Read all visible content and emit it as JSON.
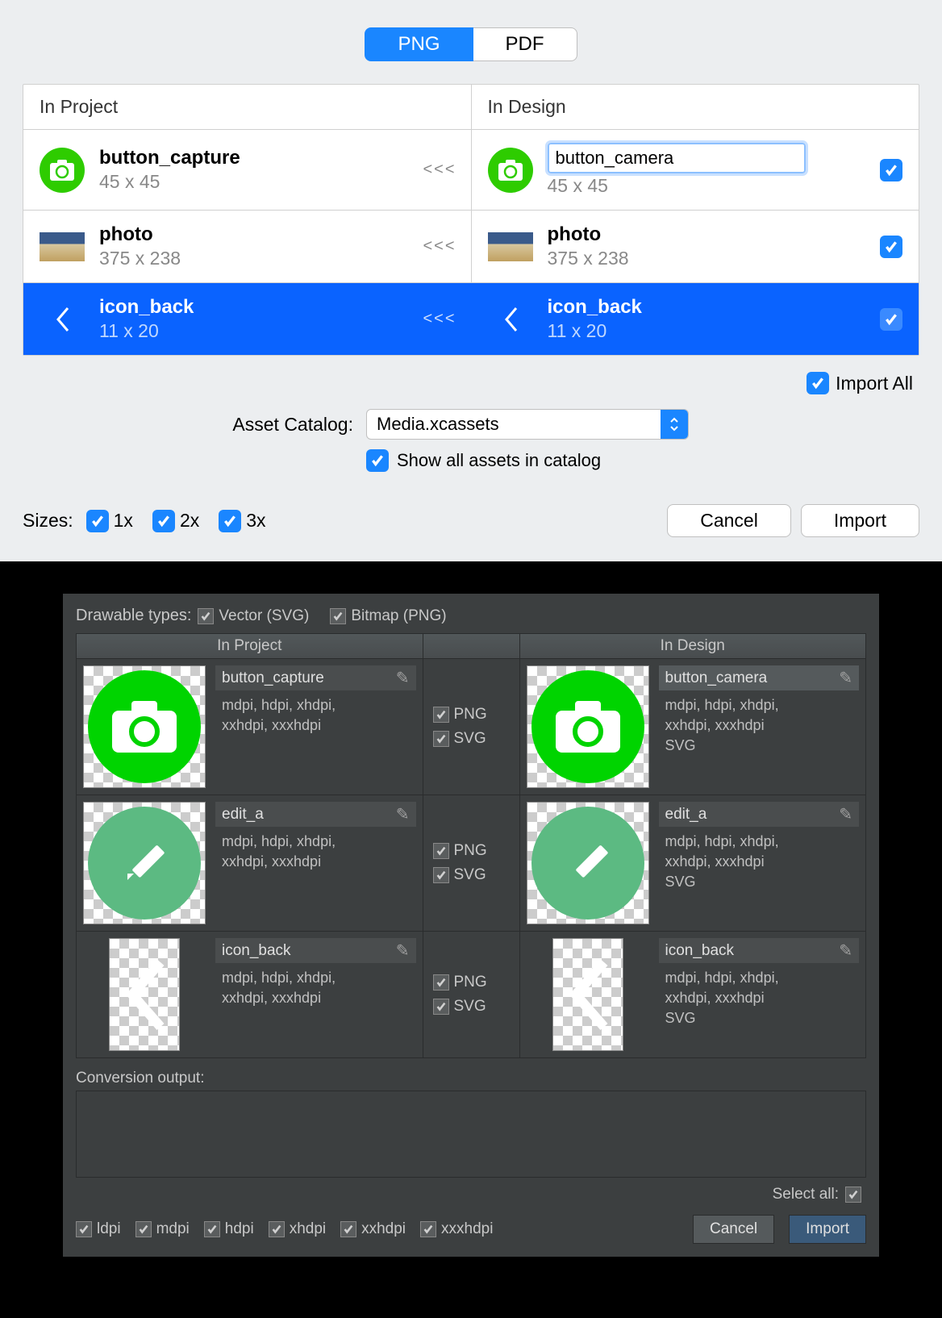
{
  "top": {
    "tabs": {
      "png": "PNG",
      "pdf": "PDF"
    },
    "headers": {
      "project": "In Project",
      "design": "In Design"
    },
    "rows": [
      {
        "project": {
          "name": "button_capture",
          "dims": "45 x 45"
        },
        "design": {
          "name": "button_camera",
          "dims": "45 x 45",
          "editing": true
        }
      },
      {
        "project": {
          "name": "photo",
          "dims": "375 x 238"
        },
        "design": {
          "name": "photo",
          "dims": "375 x 238"
        }
      },
      {
        "project": {
          "name": "icon_back",
          "dims": "11 x 20"
        },
        "design": {
          "name": "icon_back",
          "dims": "11 x 20"
        }
      }
    ],
    "arrows": "<<<",
    "importAll": "Import All",
    "catalogLabel": "Asset Catalog:",
    "catalogValue": "Media.xcassets",
    "showAll": "Show all assets in catalog",
    "sizesLabel": "Sizes:",
    "sizes": {
      "s1": "1x",
      "s2": "2x",
      "s3": "3x"
    },
    "cancel": "Cancel",
    "import": "Import"
  },
  "bottom": {
    "drawableLabel": "Drawable types:",
    "vector": "Vector (SVG)",
    "bitmap": "Bitmap (PNG)",
    "headers": {
      "project": "In Project",
      "design": "In Design"
    },
    "midPng": "PNG",
    "midSvg": "SVG",
    "rows": [
      {
        "project": {
          "name": "button_capture",
          "sub1": "mdpi, hdpi, xhdpi,",
          "sub2": "xxhdpi, xxxhdpi",
          "sub3": ""
        },
        "design": {
          "name": "button_camera",
          "sub1": "mdpi, hdpi, xhdpi,",
          "sub2": "xxhdpi, xxxhdpi",
          "sub3": "SVG"
        }
      },
      {
        "project": {
          "name": "edit_a",
          "sub1": "mdpi, hdpi, xhdpi,",
          "sub2": "xxhdpi, xxxhdpi",
          "sub3": ""
        },
        "design": {
          "name": "edit_a",
          "sub1": "mdpi, hdpi, xhdpi,",
          "sub2": "xxhdpi, xxxhdpi",
          "sub3": "SVG"
        }
      },
      {
        "project": {
          "name": "icon_back",
          "sub1": "mdpi, hdpi, xhdpi,",
          "sub2": "xxhdpi, xxxhdpi",
          "sub3": ""
        },
        "design": {
          "name": "icon_back",
          "sub1": "mdpi, hdpi, xhdpi,",
          "sub2": "xxhdpi, xxxhdpi",
          "sub3": "SVG"
        }
      }
    ],
    "convLabel": "Conversion output:",
    "selectAll": "Select all:",
    "dpis": {
      "l": "ldpi",
      "m": "mdpi",
      "h": "hdpi",
      "xh": "xhdpi",
      "xxh": "xxhdpi",
      "xxxh": "xxxhdpi"
    },
    "cancel": "Cancel",
    "import": "Import"
  }
}
